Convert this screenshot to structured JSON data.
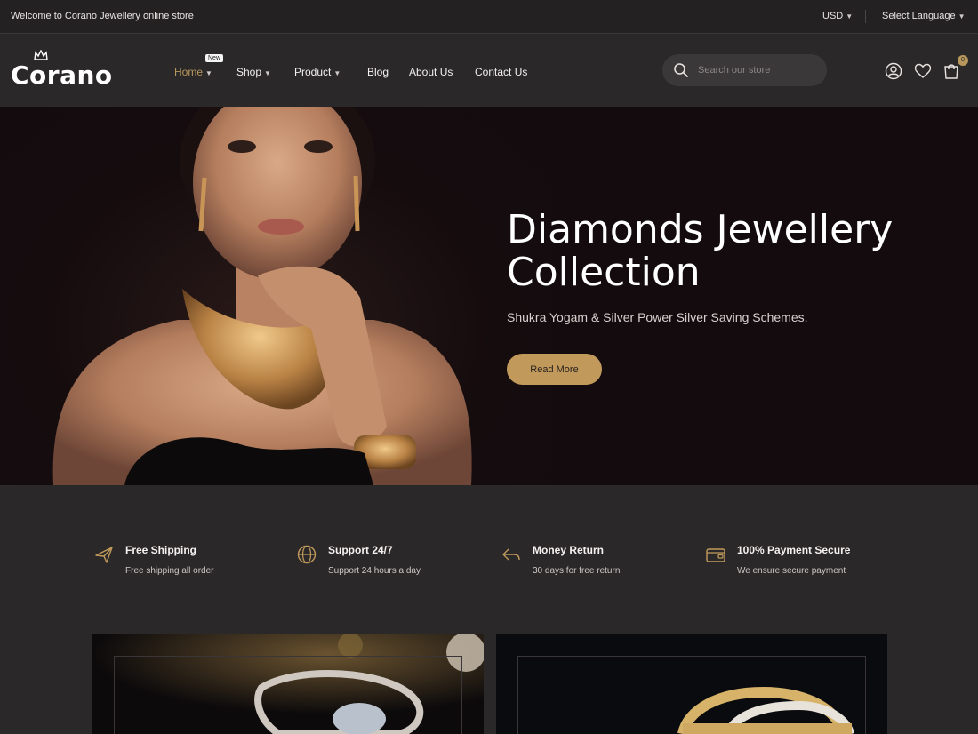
{
  "topbar": {
    "welcome": "Welcome to Corano Jewellery online store",
    "currency": "USD",
    "language": "Select Language"
  },
  "header": {
    "logo": "Corano",
    "nav": [
      {
        "label": "Home",
        "has_dropdown": true,
        "active": true,
        "badge": "New"
      },
      {
        "label": "Shop",
        "has_dropdown": true
      },
      {
        "label": "Product",
        "has_dropdown": true
      },
      {
        "label": "Blog"
      },
      {
        "label": "About Us"
      },
      {
        "label": "Contact Us"
      }
    ],
    "search_placeholder": "Search our store",
    "cart_count": "0",
    "icons": [
      "user-icon",
      "heart-icon",
      "cart-icon"
    ]
  },
  "hero": {
    "title_line1": "Diamonds Jewellery",
    "title_line2": "Collection",
    "subtitle": "Shukra Yogam & Silver Power Silver Saving Schemes.",
    "button": "Read More"
  },
  "features": [
    {
      "icon": "plane-icon",
      "title": "Free Shipping",
      "desc": "Free shipping all order"
    },
    {
      "icon": "globe-icon",
      "title": "Support 24/7",
      "desc": "Support 24 hours a day"
    },
    {
      "icon": "return-icon",
      "title": "Money Return",
      "desc": "30 days for free return"
    },
    {
      "icon": "wallet-icon",
      "title": "100% Payment Secure",
      "desc": "We ensure secure payment"
    }
  ],
  "colors": {
    "accent": "#c19a5b",
    "background": "#2a2829",
    "topbar": "#232122",
    "hero_bg": "#130b0e"
  }
}
